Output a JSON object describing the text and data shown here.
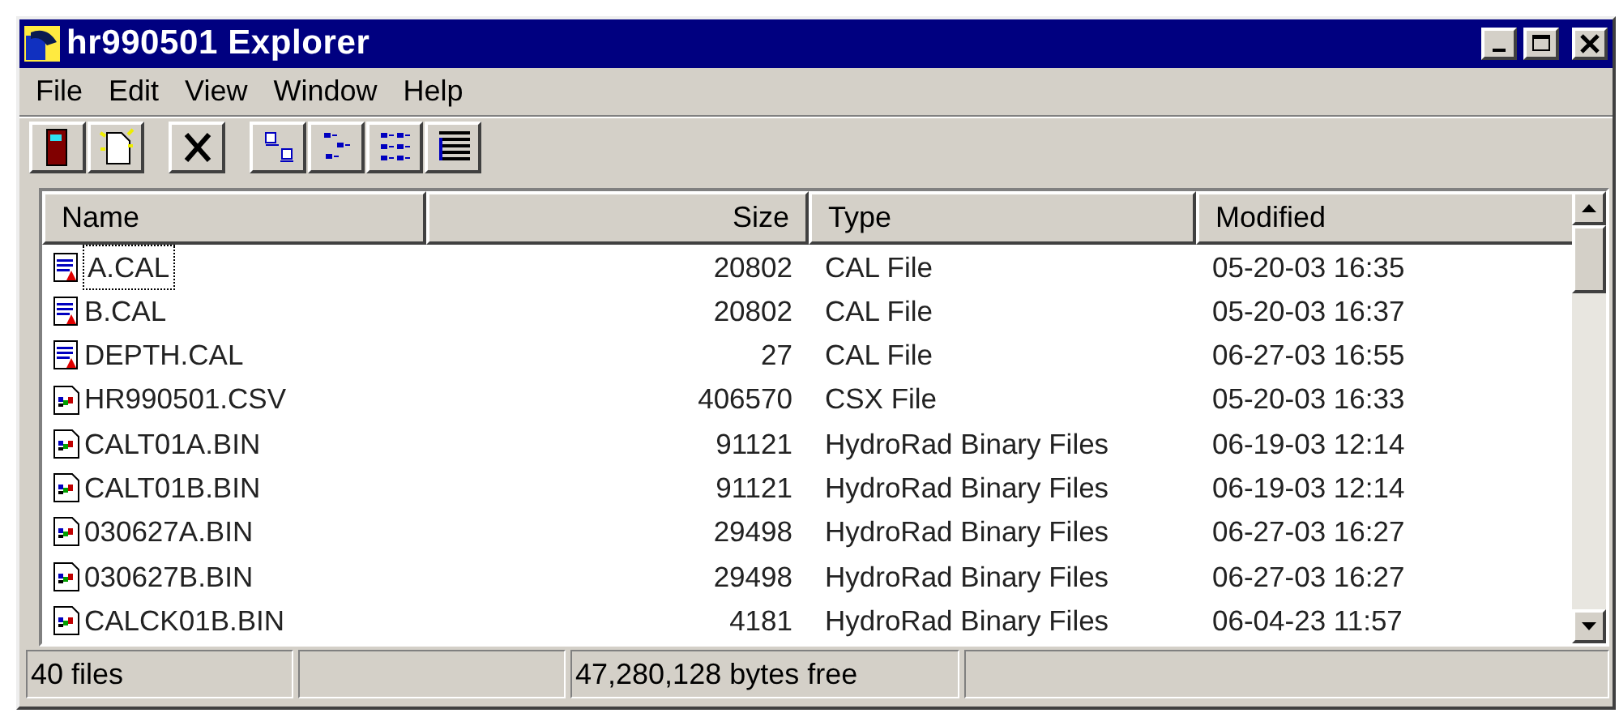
{
  "window": {
    "title": "hr990501 Explorer"
  },
  "menu": [
    "File",
    "Edit",
    "View",
    "Window",
    "Help"
  ],
  "toolbar": [
    {
      "kind": "exit"
    },
    {
      "kind": "new"
    },
    {
      "kind": "delete",
      "group_start": true
    },
    {
      "kind": "large",
      "group_start": true
    },
    {
      "kind": "small"
    },
    {
      "kind": "list"
    },
    {
      "kind": "details"
    }
  ],
  "table": {
    "columns": [
      {
        "label": "Name"
      },
      {
        "label": "Size"
      },
      {
        "label": "Type"
      },
      {
        "label": "Modified"
      }
    ],
    "rows": [
      {
        "kind": "cal",
        "focused": true,
        "cells": [
          "A.CAL",
          "20802",
          "CAL File",
          "05-20-03 16:35"
        ]
      },
      {
        "kind": "cal",
        "focused": false,
        "cells": [
          "B.CAL",
          "20802",
          "CAL File",
          "05-20-03 16:37"
        ]
      },
      {
        "kind": "cal",
        "focused": false,
        "cells": [
          "DEPTH.CAL",
          "27",
          "CAL File",
          "06-27-03 16:55"
        ]
      },
      {
        "kind": "bin",
        "focused": false,
        "cells": [
          "HR990501.CSV",
          "406570",
          "CSX File",
          "05-20-03 16:33"
        ]
      },
      {
        "kind": "bin",
        "focused": false,
        "cells": [
          "CALT01A.BIN",
          "91121",
          "HydroRad Binary Files",
          "06-19-03 12:14"
        ]
      },
      {
        "kind": "bin",
        "focused": false,
        "cells": [
          "CALT01B.BIN",
          "91121",
          "HydroRad Binary Files",
          "06-19-03 12:14"
        ]
      },
      {
        "kind": "bin",
        "focused": false,
        "cells": [
          "030627A.BIN",
          "29498",
          "HydroRad Binary Files",
          "06-27-03 16:27"
        ]
      },
      {
        "kind": "bin",
        "focused": false,
        "cells": [
          "030627B.BIN",
          "29498",
          "HydroRad Binary Files",
          "06-27-03 16:27"
        ]
      },
      {
        "kind": "bin",
        "focused": false,
        "cells": [
          "CALCK01B.BIN",
          "4181",
          "HydroRad Binary Files",
          "06-04-23 11:57"
        ]
      }
    ]
  },
  "status_bar": [
    {
      "kind": "text",
      "text": "40 files"
    },
    {
      "kind": "blank"
    },
    {
      "kind": "text",
      "text": "47,280,128 bytes free"
    },
    {
      "kind": "blank"
    }
  ]
}
